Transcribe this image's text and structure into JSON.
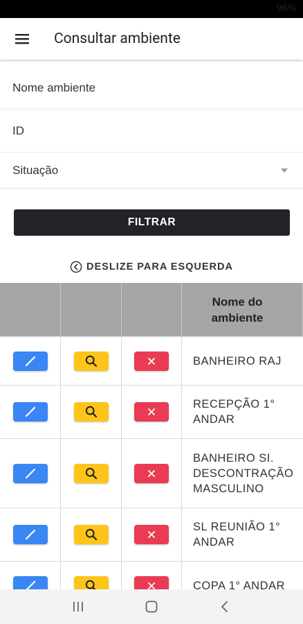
{
  "status_bar": {
    "battery_text": "96%"
  },
  "app_bar": {
    "title": "Consultar ambiente",
    "menu_icon": "hamburger-menu-icon"
  },
  "filters": {
    "name_placeholder": "Nome ambiente",
    "id_placeholder": "ID",
    "status_placeholder": "Situação",
    "filter_label": "FILTRAR"
  },
  "swipe_hint": {
    "text": "DESLIZE PARA ESQUERDA",
    "icon": "chevron-left-circle-icon"
  },
  "table": {
    "header": {
      "name_column": "Nome do ambiente"
    },
    "actions": {
      "edit_icon": "pencil-icon",
      "view_icon": "search-icon",
      "delete_icon": "close-icon"
    },
    "rows": [
      {
        "name": "BANHEIRO RAJ"
      },
      {
        "name": "RECEPÇÃO 1° ANDAR"
      },
      {
        "name": "BANHEIRO SI. DESCONTRAÇÃO MASCULINO"
      },
      {
        "name": "SL REUNIÃO 1° ANDAR"
      },
      {
        "name": "COPA 1° ANDAR"
      }
    ]
  },
  "colors": {
    "edit": "#3a86f4",
    "view": "#fdc51a",
    "delete": "#ea3b55",
    "filter_button": "#222326",
    "table_header": "#a6a6a6"
  },
  "nav_bar": {
    "icons": [
      "recent-apps-icon",
      "home-icon",
      "back-icon"
    ]
  }
}
